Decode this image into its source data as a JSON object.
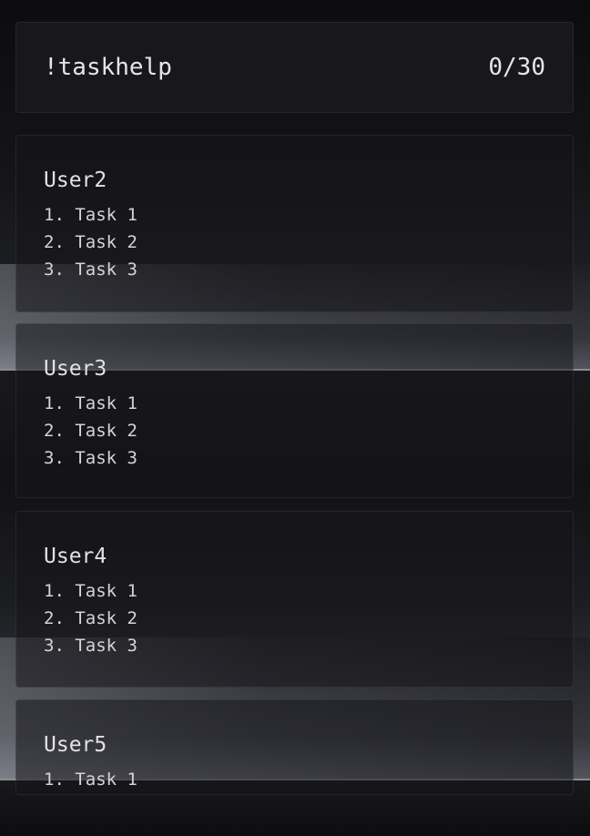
{
  "header": {
    "command": "!taskhelp",
    "count": "0/30"
  },
  "users": [
    {
      "name": "User2",
      "tasks": [
        "1. Task 1",
        "2. Task 2",
        "3. Task 3"
      ]
    },
    {
      "name": "User3",
      "tasks": [
        "1. Task 1",
        "2. Task 2",
        "3. Task 3"
      ]
    },
    {
      "name": "User4",
      "tasks": [
        "1. Task 1",
        "2. Task 2",
        "3. Task 3"
      ]
    },
    {
      "name": "User5",
      "tasks": [
        "1. Task 1"
      ]
    }
  ]
}
